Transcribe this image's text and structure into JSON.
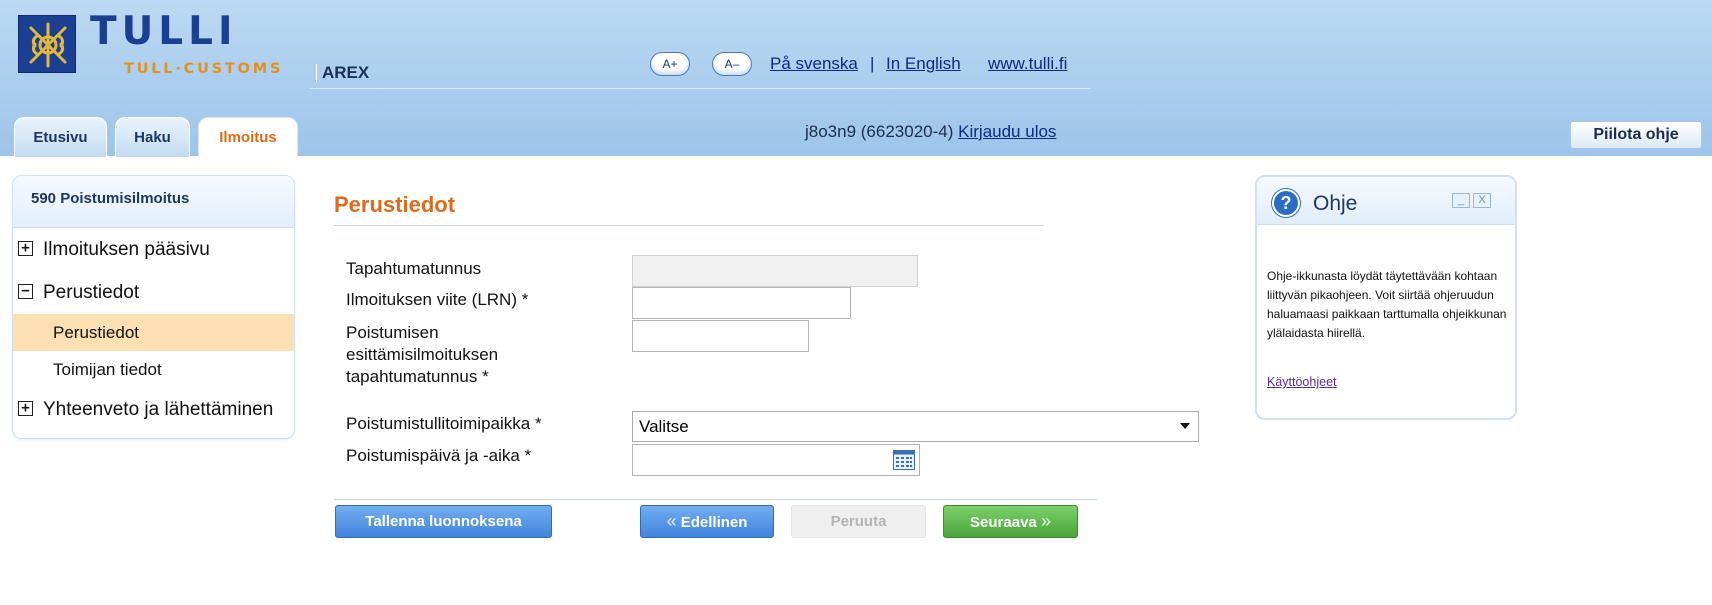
{
  "header": {
    "logo": {
      "name": "TULLI",
      "subtitle": "TULL·CUSTOMS"
    },
    "app_name": "AREX",
    "font_increase": "A+",
    "font_decrease": "A–",
    "lang_sv": "På svenska",
    "separator": "|",
    "lang_en": "In English",
    "site_link": "www.tulli.fi",
    "user": "j8o3n9 (6623020-4)",
    "logout": "Kirjaudu ulos",
    "hide_help": "Piilota ohje"
  },
  "tabs": [
    {
      "label": "Etusivu",
      "active": false
    },
    {
      "label": "Haku",
      "active": false
    },
    {
      "label": "Ilmoitus",
      "active": true
    }
  ],
  "sidebar": {
    "title": "590 Poistumisilmoitus",
    "items": [
      {
        "label": "Ilmoituksen pääsivu",
        "toggle": "+"
      },
      {
        "label": "Perustiedot",
        "toggle": "−"
      },
      {
        "label": "Perustiedot",
        "selected": true
      },
      {
        "label": "Toimijan tiedot"
      },
      {
        "label": "Yhteenveto ja lähettäminen",
        "toggle": "+"
      }
    ]
  },
  "form": {
    "section_title": "Perustiedot",
    "fields": {
      "event_id": {
        "label": "Tapahtumatunnus",
        "value": ""
      },
      "lrn": {
        "label": "Ilmoituksen viite (LRN) *",
        "value": ""
      },
      "presentation_id": {
        "label_lines": [
          "Poistumisen",
          "esittämisilmoituksen",
          "tapahtumatunnus *"
        ],
        "value": ""
      },
      "exit_office": {
        "label": "Poistumistullitoimipaikka *",
        "selected": "Valitse"
      },
      "exit_datetime": {
        "label": "Poistumispäivä ja -aika *",
        "value": ""
      }
    }
  },
  "buttons": {
    "save_draft": "Tallenna luonnoksena",
    "previous": "Edellinen",
    "cancel": "Peruuta",
    "next": "Seuraava"
  },
  "help": {
    "title": "Ohje",
    "minimize": "_",
    "close": "X",
    "text": "Ohje-ikkunasta löydät täytettävään kohtaan liittyvän pikaohjeen. Voit siirtää ohjeruudun haluamaasi paikkaan tarttumalla ohjeikkunan ylälaidasta hiirellä.",
    "link": "Käyttöohjeet"
  },
  "icons": {
    "logo": "tulli-emblem-icon",
    "help": "question-circle-icon",
    "calendar": "calendar-icon",
    "dropdown": "chevron-down-icon"
  },
  "colors": {
    "header_bg": "#a9cdee",
    "brand_blue": "#1b3f93",
    "accent_orange": "#de6b1c",
    "selected_nav": "#fde0b2",
    "button_blue": "#3f84dc",
    "button_green": "#49a53a"
  }
}
